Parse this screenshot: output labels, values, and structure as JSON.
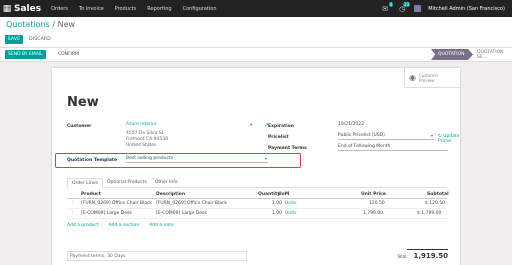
{
  "navbar": {
    "brand": "Sales",
    "menu": [
      "Orders",
      "To Invoice",
      "Products",
      "Reporting",
      "Configuration"
    ],
    "chat_badge": "4",
    "activity_badge": "23",
    "user": "Mitchell Admin (San Francisco)"
  },
  "breadcrumb": {
    "parent": "Quotations",
    "separator": " / ",
    "current": "New"
  },
  "buttons": {
    "save": "SAVE",
    "discard": "DISCARD"
  },
  "statusbar": {
    "send": "SEND BY EMAIL",
    "confirm": "CONFIRM",
    "stage_active": "QUOTATION",
    "stage_next": "QUOTATION SE..."
  },
  "smart_button": {
    "line1": "Customer",
    "line2": "Preview"
  },
  "form": {
    "title": "New",
    "customer_label": "Customer",
    "customer_value": "Azure Interior",
    "address": [
      "4557 De Silva St",
      "Fremont CA 94538",
      "United States"
    ],
    "quotation_template_label": "Quotation Template",
    "quotation_template_value": "Best selling products",
    "expiration_label": "Expiration",
    "expiration_value": "10/21/2022",
    "pricelist_label": "Pricelist",
    "pricelist_value": "Public Pricelist (USD)",
    "update_prices": "Update Prices",
    "payment_terms_label": "Payment Terms",
    "payment_terms_value": "End of Following Month"
  },
  "tabs": [
    "Order Lines",
    "Optional Products",
    "Other Info"
  ],
  "table": {
    "headers": [
      "Product",
      "Description",
      "Quantity",
      "UoM",
      "Unit Price",
      "Subtotal"
    ],
    "rows": [
      {
        "product": "[FURN_0269] Office Chair Black",
        "description": "[FURN_0269] Office Chair Black",
        "quantity": "1.00",
        "uom": "Units",
        "unit_price": "120.50",
        "subtotal": "$ 120.50"
      },
      {
        "product": "[E-COM09] Large Desk",
        "description": "[E-COM09] Large Desk",
        "quantity": "1.00",
        "uom": "Units",
        "unit_price": "1,799.00",
        "subtotal": "$ 1,799.00"
      }
    ],
    "add_product": "Add a product",
    "add_section": "Add a section",
    "add_note": "Add a note"
  },
  "footer": {
    "note": "Payment terms: 30 Days",
    "total_label": "Total:",
    "total_value": "1,919.50"
  }
}
